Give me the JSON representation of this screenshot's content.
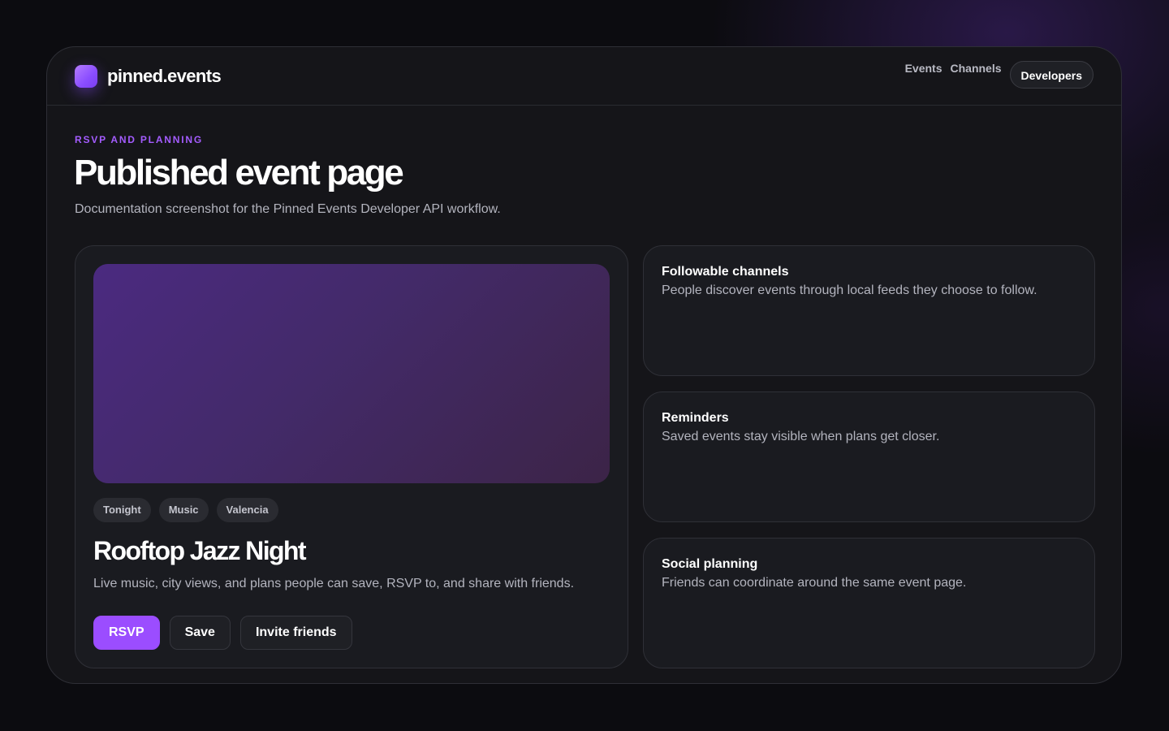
{
  "brand": {
    "name": "pinned.events",
    "accent_color": "#9b4dff"
  },
  "nav": {
    "events": "Events",
    "channels": "Channels",
    "developers": "Developers"
  },
  "page": {
    "eyebrow": "RSVP AND PLANNING",
    "title": "Published event page",
    "subtitle": "Documentation screenshot for the Pinned Events Developer API workflow."
  },
  "event": {
    "image_icon": "event-hero-image",
    "tags": [
      "Tonight",
      "Music",
      "Valencia"
    ],
    "title": "Rooftop Jazz Night",
    "description": "Live music, city views, and plans people can save, RSVP to, and share with friends.",
    "actions": {
      "rsvp": "RSVP",
      "save": "Save",
      "invite": "Invite friends"
    }
  },
  "features": [
    {
      "title": "Followable channels",
      "description": "People discover events through local feeds they choose to follow."
    },
    {
      "title": "Reminders",
      "description": "Saved events stay visible when plans get closer."
    },
    {
      "title": "Social planning",
      "description": "Friends can coordinate around the same event page."
    }
  ]
}
